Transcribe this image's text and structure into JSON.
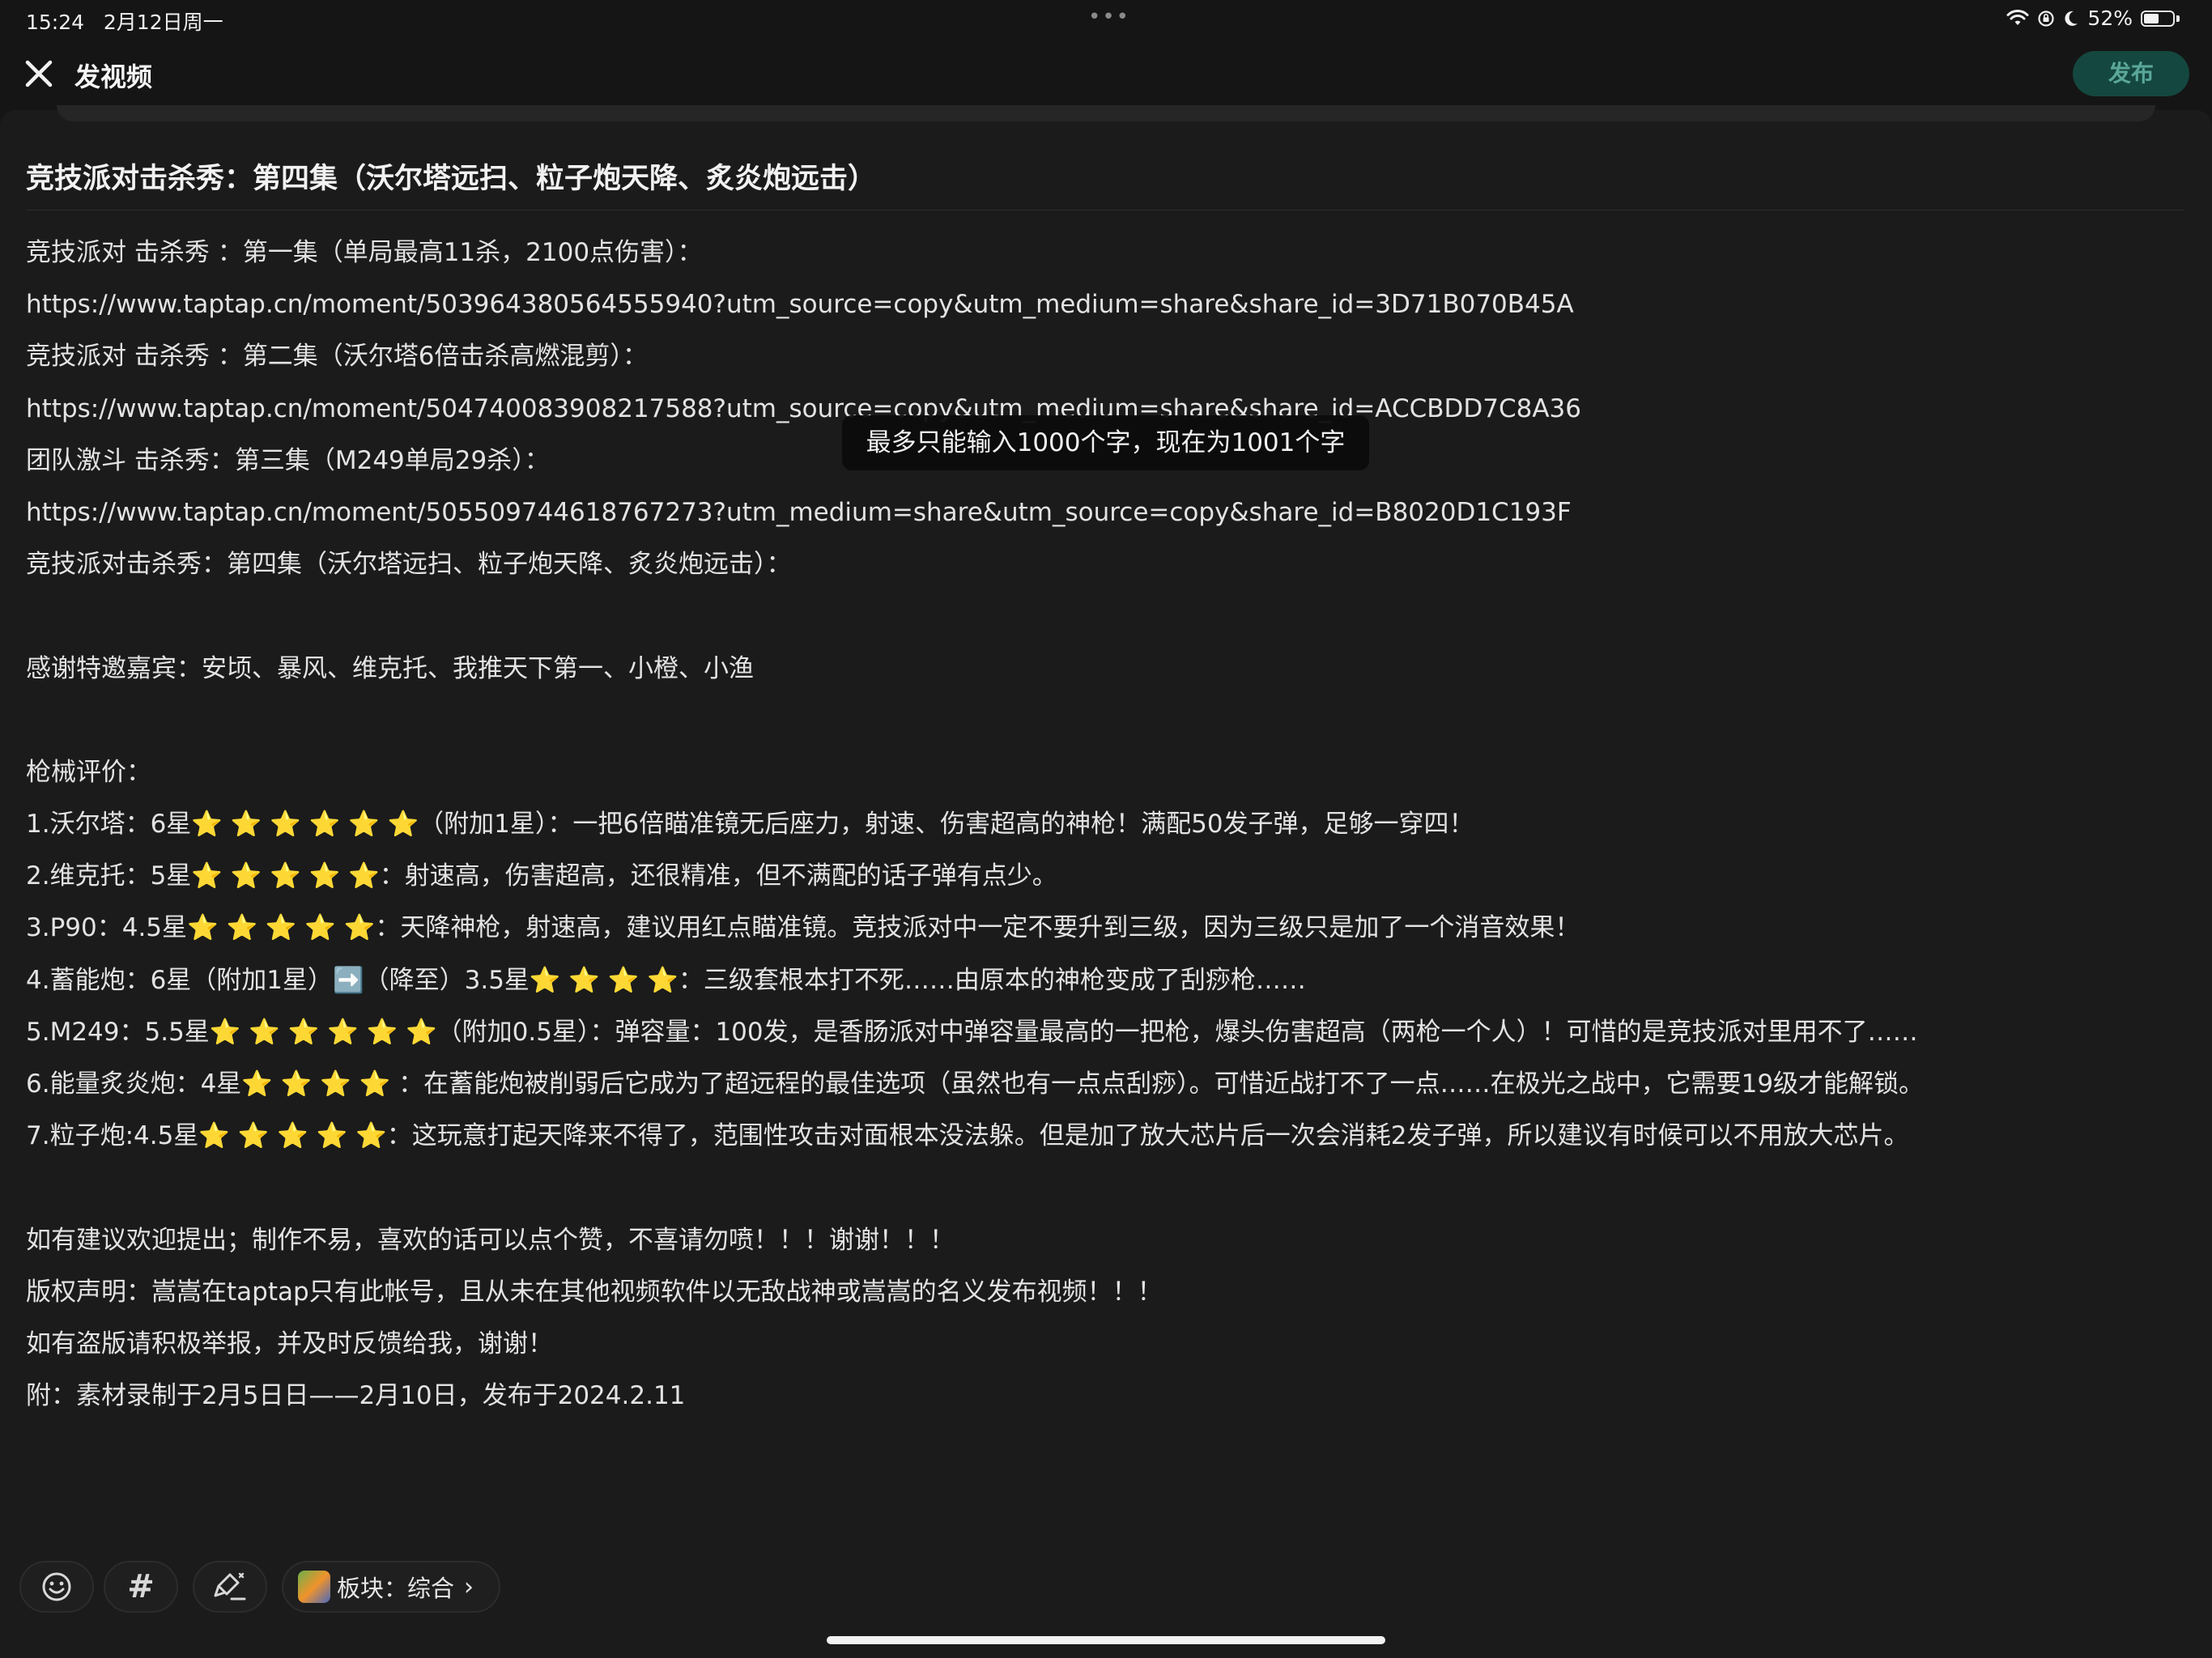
{
  "status": {
    "time": "15:24",
    "date": "2月12日周一",
    "dots": "•••",
    "battery": "52%",
    "battery_level": 0.52
  },
  "nav": {
    "title": "发视频",
    "publish_label": "发布"
  },
  "post": {
    "title": "竞技派对击杀秀：第四集（沃尔塔远扫、粒子炮天降、炙炎炮远击）",
    "lines": [
      "竞技派对 击杀秀 ：第一集（单局最高11杀，2100点伤害）：",
      "https://www.taptap.cn/moment/503964380564555940?utm_source=copy&utm_medium=share&share_id=3D71B070B45A",
      "竞技派对 击杀秀 ：第二集（沃尔塔6倍击杀高燃混剪）：",
      "https://www.taptap.cn/moment/504740083908217588?utm_source=copy&utm_medium=share&share_id=ACCBDD7C8A36",
      "团队激斗 击杀秀：第三集（M249单局29杀）：",
      "https://www.taptap.cn/moment/505509744618767273?utm_medium=share&utm_source=copy&share_id=B8020D1C193F",
      "竞技派对击杀秀：第四集（沃尔塔远扫、粒子炮天降、炙炎炮远击）：",
      "",
      "感谢特邀嘉宾：安顷、暴风、维克托、我推天下第一、小橙、小渔",
      "",
      "枪械评价：",
      "1.沃尔塔：6星⭐️ ⭐️ ⭐️ ⭐️ ⭐️ ⭐️（附加1星）：一把6倍瞄准镜无后座力，射速、伤害超高的神枪！满配50发子弹，足够一穿四！",
      "2.维克托：5星⭐️ ⭐️ ⭐️ ⭐️ ⭐️：射速高，伤害超高，还很精准，但不满配的话子弹有点少。",
      "3.P90：4.5星⭐️ ⭐️ ⭐️ ⭐️ ⭐️：天降神枪，射速高，建议用红点瞄准镜。竞技派对中一定不要升到三级，因为三级只是加了一个消音效果！",
      "4.蓄能炮：6星（附加1星）➡️（降至）3.5星⭐️ ⭐️ ⭐️ ⭐️：三级套根本打不死……由原本的神枪变成了刮痧枪……",
      "5.M249：5.5星⭐️ ⭐️ ⭐️ ⭐️ ⭐️ ⭐️（附加0.5星）：弹容量：100发，是香肠派对中弹容量最高的一把枪，爆头伤害超高（两枪一个人）！可惜的是竞技派对里用不了……",
      "6.能量炙炎炮：4星⭐️ ⭐️ ⭐️ ⭐️ ：在蓄能炮被削弱后它成为了超远程的最佳选项（虽然也有一点点刮痧）。可惜近战打不了一点……在极光之战中，它需要19级才能解锁。",
      "7.粒子炮:4.5星⭐️ ⭐️ ⭐️ ⭐️ ⭐️：这玩意打起天降来不得了，范围性攻击对面根本没法躲。但是加了放大芯片后一次会消耗2发子弹，所以建议有时候可以不用放大芯片。",
      "",
      "如有建议欢迎提出；制作不易，喜欢的话可以点个赞，不喜请勿喷！！！谢谢！！！",
      "版权声明：嵩嵩在taptap只有此帐号，且从未在其他视频软件以无敌战神或嵩嵩的名义发布视频！！！",
      "如有盗版请积极举报，并及时反馈给我，谢谢！",
      "附：素材录制于2月5日日——2月10日，发布于2024.2.11"
    ]
  },
  "toast": "最多只能输入1000个字，现在为1001个字",
  "toolbar": {
    "hash_symbol": "#",
    "board_label": "板块：综合",
    "board_chevron": "›"
  },
  "icons": {
    "close": "close-icon",
    "emoji": "emoji-icon",
    "hash": "hashtag-icon",
    "clear": "clear-format-icon",
    "wifi": "wifi-icon",
    "lock_rotation": "rotation-lock-icon",
    "moon": "moon-icon",
    "battery": "battery-icon"
  },
  "colors": {
    "background": "#151515",
    "panel": "#1b1b1b",
    "publish_bg": "#14473f",
    "publish_text": "#5aa79a",
    "text": "#e3e3e3"
  }
}
